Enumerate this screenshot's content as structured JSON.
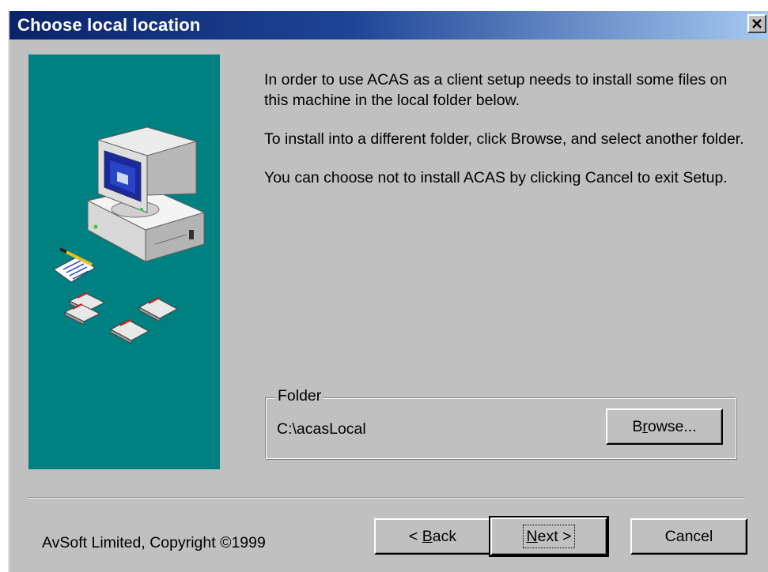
{
  "window": {
    "title": "Choose local location"
  },
  "intro": {
    "paragraph_1": "In order to use ACAS as a client setup needs to install some files on this machine in the local folder below.",
    "paragraph_2": "To install into a different folder, click Browse, and select another folder.",
    "paragraph_3": "You can choose not to install ACAS by clicking Cancel to exit Setup."
  },
  "folder_group": {
    "legend": "Folder",
    "path": "C:\\acasLocal",
    "browse": {
      "pre": "B",
      "accel": "r",
      "post": "owse..."
    }
  },
  "footer": {
    "copyright": "AvSoft Limited, Copyright ©1999"
  },
  "buttons": {
    "back": {
      "pre": "< ",
      "accel": "B",
      "post": "ack"
    },
    "next": {
      "pre": "",
      "accel": "N",
      "post": "ext >"
    },
    "cancel": "Cancel"
  },
  "icons": {
    "close": "close-icon",
    "illustration": "computer-setup-illustration"
  },
  "colors": {
    "title_bar_start": "#0a246a",
    "title_bar_end": "#a6caf0",
    "dialog_face": "#c0c0c0",
    "side_panel": "#008080"
  }
}
